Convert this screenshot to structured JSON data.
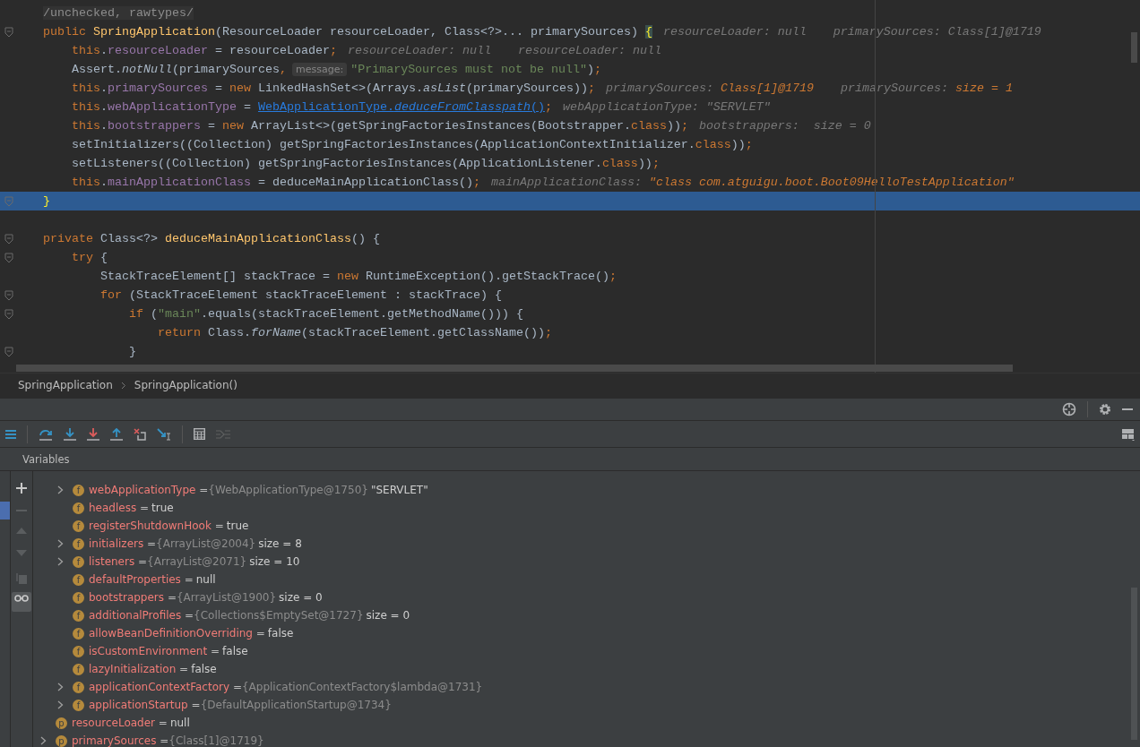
{
  "code_lines": [
    {
      "fold": false,
      "current": false,
      "tokens": [
        {
          "t": "/unchecked, rawtypes/",
          "kind": "doc"
        }
      ]
    },
    {
      "fold": true,
      "current": false,
      "tokens": [
        {
          "t": "public ",
          "kind": "kw"
        },
        {
          "t": "SpringApplication",
          "kind": "fn"
        },
        {
          "t": "(ResourceLoader resourceLoader, Class<?>... primarySources) ",
          "kind": "plain"
        },
        {
          "t": "{",
          "kind": "brace"
        },
        {
          "t": "resourceLoader: null",
          "kind": "hint"
        },
        {
          "t": "primarySources: Class[1]@1719",
          "kind": "hint"
        }
      ],
      "children": [
        {
          "fold": false,
          "current": false,
          "tokens": [
            {
              "t": "this",
              "kind": "kw"
            },
            {
              "t": ".",
              "kind": "plain"
            },
            {
              "t": "resourceLoader",
              "kind": "field"
            },
            {
              "t": " = resourceLoader",
              "kind": "plain"
            },
            {
              "t": ";",
              "kind": "kw"
            },
            {
              "t": "resourceLoader: null",
              "kind": "hint"
            },
            {
              "t": "resourceLoader: null",
              "kind": "hint"
            }
          ]
        },
        {
          "fold": false,
          "current": false,
          "tokens": [
            {
              "t": "Assert.",
              "kind": "plain"
            },
            {
              "t": "notNull",
              "kind": "ital"
            },
            {
              "t": "(primarySources",
              "kind": "plain"
            },
            {
              "t": ",",
              "kind": "kw"
            },
            {
              "t": "message:",
              "kind": "label"
            },
            {
              "t": "\"PrimarySources must not be null\"",
              "kind": "str"
            },
            {
              "t": ")",
              "kind": "plain"
            },
            {
              "t": ";",
              "kind": "kw"
            }
          ]
        },
        {
          "fold": false,
          "current": false,
          "tokens": [
            {
              "t": "this",
              "kind": "kw"
            },
            {
              "t": ".",
              "kind": "plain"
            },
            {
              "t": "primarySources",
              "kind": "field"
            },
            {
              "t": " = ",
              "kind": "plain"
            },
            {
              "t": "new ",
              "kind": "kw"
            },
            {
              "t": "LinkedHashSet<>(Arrays.",
              "kind": "plain"
            },
            {
              "t": "asList",
              "kind": "ital"
            },
            {
              "t": "(primarySources))",
              "kind": "plain"
            },
            {
              "t": ";",
              "kind": "kw"
            },
            {
              "t": "primarySources:",
              "kind": "hint"
            },
            {
              "t": "Class[1]@1719",
              "kind": "hintv"
            },
            {
              "t": "primarySources:",
              "kind": "hint"
            },
            {
              "t": "size = 1",
              "kind": "hintv"
            }
          ]
        },
        {
          "fold": false,
          "current": false,
          "tokens": [
            {
              "t": "this",
              "kind": "kw"
            },
            {
              "t": ".",
              "kind": "plain"
            },
            {
              "t": "webApplicationType",
              "kind": "field"
            },
            {
              "t": " = ",
              "kind": "plain"
            },
            {
              "t": "WebApplicationType.",
              "kind": "link"
            },
            {
              "t": "deduceFromClasspath",
              "kind": "linkital"
            },
            {
              "t": "()",
              "kind": "link"
            },
            {
              "t": ";",
              "kind": "kw"
            },
            {
              "t": "webApplicationType: \"SERVLET\"",
              "kind": "hint"
            }
          ]
        },
        {
          "fold": false,
          "current": false,
          "tokens": [
            {
              "t": "this",
              "kind": "kw"
            },
            {
              "t": ".",
              "kind": "plain"
            },
            {
              "t": "bootstrappers",
              "kind": "field"
            },
            {
              "t": " = ",
              "kind": "plain"
            },
            {
              "t": "new ",
              "kind": "kw"
            },
            {
              "t": "ArrayList<>(getSpringFactoriesInstances(Bootstrapper.",
              "kind": "plain"
            },
            {
              "t": "class",
              "kind": "kw"
            },
            {
              "t": "))",
              "kind": "plain"
            },
            {
              "t": ";",
              "kind": "kw"
            },
            {
              "t": "bootstrappers:  size = 0",
              "kind": "hint"
            }
          ]
        },
        {
          "fold": false,
          "current": false,
          "tokens": [
            {
              "t": "setInitializers((Collection) getSpringFactoriesInstances(ApplicationContextInitializer.",
              "kind": "plain"
            },
            {
              "t": "class",
              "kind": "kw"
            },
            {
              "t": "))",
              "kind": "plain"
            },
            {
              "t": ";",
              "kind": "kw"
            }
          ]
        },
        {
          "fold": false,
          "current": false,
          "tokens": [
            {
              "t": "setListeners((Collection) getSpringFactoriesInstances(ApplicationListener.",
              "kind": "plain"
            },
            {
              "t": "class",
              "kind": "kw"
            },
            {
              "t": "))",
              "kind": "plain"
            },
            {
              "t": ";",
              "kind": "kw"
            }
          ]
        },
        {
          "fold": false,
          "current": false,
          "tokens": [
            {
              "t": "this",
              "kind": "kw"
            },
            {
              "t": ".",
              "kind": "plain"
            },
            {
              "t": "mainApplicationClass",
              "kind": "field"
            },
            {
              "t": " = deduceMainApplicationClass()",
              "kind": "plain"
            },
            {
              "t": ";",
              "kind": "kw"
            },
            {
              "t": "mainApplicationClass:",
              "kind": "hint"
            },
            {
              "t": "\"class com.atguigu.boot.Boot09HelloTestApplication\"",
              "kind": "hintv"
            }
          ]
        }
      ]
    },
    {
      "fold": true,
      "current": true,
      "tokens": [
        {
          "t": "}",
          "kind": "curbrace"
        }
      ]
    },
    {
      "fold": false,
      "current": false
    },
    {
      "fold": true,
      "current": false,
      "tokens": [
        {
          "t": "private ",
          "kind": "kw"
        },
        {
          "t": "Class<?> ",
          "kind": "plain"
        },
        {
          "t": "deduceMainApplicationClass",
          "kind": "fn"
        },
        {
          "t": "() {",
          "kind": "plain"
        }
      ],
      "children": [
        {
          "fold": true,
          "current": false,
          "tokens": [
            {
              "t": "try ",
              "kind": "kw"
            },
            {
              "t": "{",
              "kind": "plain"
            }
          ],
          "children": [
            {
              "fold": false,
              "current": false,
              "tokens": [
                {
                  "t": "StackTraceElement[] stackTrace = ",
                  "kind": "plain"
                },
                {
                  "t": "new ",
                  "kind": "kw"
                },
                {
                  "t": "RuntimeException().getStackTrace()",
                  "kind": "plain"
                },
                {
                  "t": ";",
                  "kind": "kw"
                }
              ]
            },
            {
              "fold": true,
              "current": false,
              "tokens": [
                {
                  "t": "for ",
                  "kind": "kw"
                },
                {
                  "t": "(StackTraceElement stackTraceElement : stackTrace) {",
                  "kind": "plain"
                }
              ],
              "children": [
                {
                  "fold": true,
                  "current": false,
                  "tokens": [
                    {
                      "t": "if ",
                      "kind": "kw"
                    },
                    {
                      "t": "(",
                      "kind": "plain"
                    },
                    {
                      "t": "\"main\"",
                      "kind": "str"
                    },
                    {
                      "t": ".equals(stackTraceElement.getMethodName())) {",
                      "kind": "plain"
                    }
                  ],
                  "children": [
                    {
                      "fold": false,
                      "current": false,
                      "tokens": [
                        {
                          "t": "return ",
                          "kind": "kw"
                        },
                        {
                          "t": "Class.",
                          "kind": "plain"
                        },
                        {
                          "t": "forName",
                          "kind": "ital"
                        },
                        {
                          "t": "(stackTraceElement.getClassName())",
                          "kind": "plain"
                        },
                        {
                          "t": ";",
                          "kind": "kw"
                        }
                      ]
                    }
                  ]
                },
                {
                  "fold": true,
                  "current": false,
                  "tokens": [
                    {
                      "t": "}",
                      "kind": "plain"
                    }
                  ]
                }
              ]
            }
          ]
        }
      ]
    }
  ],
  "breadcrumbs": [
    "SpringApplication",
    "SpringApplication()"
  ],
  "variables_tab": "Variables",
  "variables": [
    {
      "kind": "field",
      "badge": "f",
      "expandable": true,
      "name": "webApplicationType",
      "op": "=",
      "ref": "{WebApplicationType@1750}",
      "value": "\"SERVLET\""
    },
    {
      "kind": "field",
      "badge": "f",
      "expandable": false,
      "name": "headless",
      "op": "=",
      "value": "true"
    },
    {
      "kind": "field",
      "badge": "f",
      "expandable": false,
      "name": "registerShutdownHook",
      "op": "=",
      "value": "true"
    },
    {
      "kind": "field",
      "badge": "f",
      "expandable": true,
      "name": "initializers",
      "op": "=",
      "ref": "{ArrayList@2004}",
      "value": "size = 8"
    },
    {
      "kind": "field",
      "badge": "f",
      "expandable": true,
      "name": "listeners",
      "op": "=",
      "ref": "{ArrayList@2071}",
      "value": "size = 10"
    },
    {
      "kind": "field",
      "badge": "f",
      "expandable": false,
      "name": "defaultProperties",
      "op": "=",
      "value": "null"
    },
    {
      "kind": "field",
      "badge": "f",
      "expandable": false,
      "name": "bootstrappers",
      "op": "=",
      "ref": "{ArrayList@1900}",
      "value": "size = 0"
    },
    {
      "kind": "field",
      "badge": "f",
      "expandable": false,
      "name": "additionalProfiles",
      "op": "=",
      "ref": "{Collections$EmptySet@1727}",
      "value": "size = 0"
    },
    {
      "kind": "field",
      "badge": "f",
      "expandable": false,
      "name": "allowBeanDefinitionOverriding",
      "op": "=",
      "value": "false"
    },
    {
      "kind": "field",
      "badge": "f",
      "expandable": false,
      "name": "isCustomEnvironment",
      "op": "=",
      "value": "false"
    },
    {
      "kind": "field",
      "badge": "f",
      "expandable": false,
      "name": "lazyInitialization",
      "op": "=",
      "value": "false"
    },
    {
      "kind": "field",
      "badge": "f",
      "expandable": true,
      "name": "applicationContextFactory",
      "op": "=",
      "ref": "{ApplicationContextFactory$lambda@1731}"
    },
    {
      "kind": "field",
      "badge": "f",
      "expandable": true,
      "name": "applicationStartup",
      "op": "=",
      "ref": "{DefaultApplicationStartup@1734}"
    },
    {
      "kind": "param",
      "badge": "p",
      "expandable": false,
      "name": "resourceLoader",
      "op": "=",
      "value": "null"
    },
    {
      "kind": "param",
      "badge": "p",
      "expandable": true,
      "name": "primarySources",
      "op": "=",
      "ref": "{Class[1]@1719}"
    }
  ]
}
